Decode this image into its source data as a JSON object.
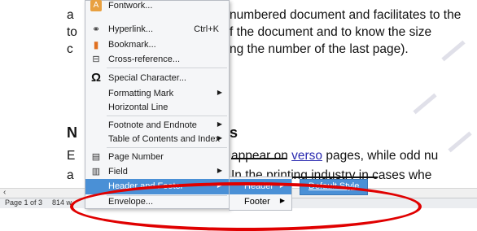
{
  "document": {
    "line1_start": "a",
    "line1_end": "numbered document and facilitates to the",
    "line2_start": "to",
    "line2_end": "f the document and to know the size",
    "line3_start": "c",
    "line3_end": "ng the number of the last page).",
    "heading_start": "N",
    "heading_end": "s",
    "line4_start": "E",
    "line4_a": "appear on",
    "line4_link": "verso",
    "line4_b": "pages, while odd nu",
    "line5_start": "a",
    "line5_end": "In the printing industry in cases whe"
  },
  "menu": {
    "items": [
      {
        "label": "Fontwork...",
        "icon": "fontwork-icon"
      },
      {
        "label": "Hyperlink...",
        "shortcut": "Ctrl+K",
        "icon": "hyperlink-icon"
      },
      {
        "label": "Bookmark...",
        "icon": "bookmark-icon"
      },
      {
        "label": "Cross-reference...",
        "icon": "cross-reference-icon"
      },
      {
        "label": "Special Character...",
        "icon": "omega-icon",
        "glyph": "Ω"
      },
      {
        "label": "Formatting Mark"
      },
      {
        "label": "Horizontal Line"
      },
      {
        "label": "Footnote and Endnote"
      },
      {
        "label": "Table of Contents and Index"
      },
      {
        "label": "Page Number",
        "icon": "page-number-icon"
      },
      {
        "label": "Field",
        "icon": "field-icon"
      },
      {
        "label": "Header and Footer"
      },
      {
        "label": "Envelope..."
      }
    ]
  },
  "submenu": {
    "header": "Header",
    "footer": "Footer"
  },
  "submenu2": {
    "default_style": "Default Style"
  },
  "statusbar": {
    "page": "Page 1 of 3",
    "words": "814 w"
  },
  "colors": {
    "highlight": "#4a90d6",
    "annotation": "#e00000"
  }
}
